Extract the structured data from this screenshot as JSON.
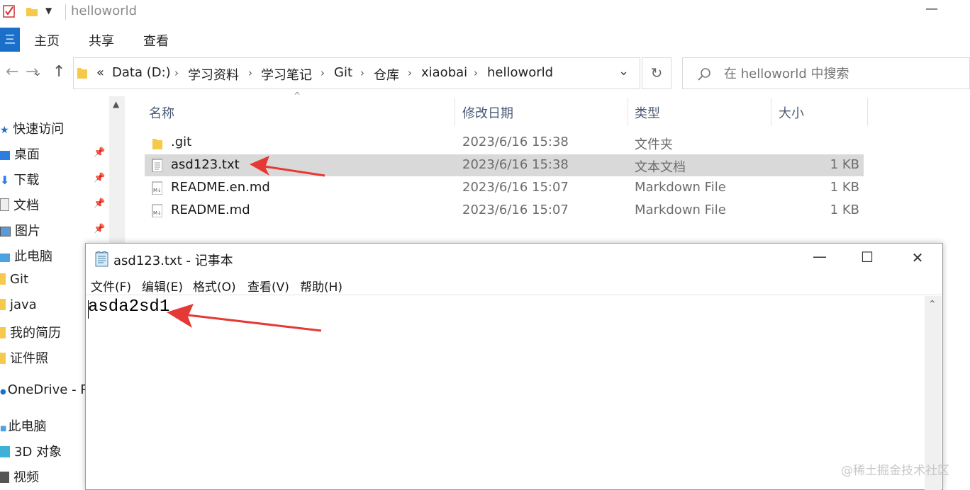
{
  "window": {
    "title": "helloworld",
    "minimize": "—"
  },
  "ribbon": {
    "file_tab": "三",
    "tabs": [
      "主页",
      "共享",
      "查看"
    ]
  },
  "address": {
    "overflow": "«",
    "crumbs": [
      "Data (D:)",
      "学习资料",
      "学习笔记",
      "Git",
      "仓库",
      "xiaobai",
      "helloworld"
    ],
    "separator": "›",
    "dropdown": "⌄",
    "refresh": "↻"
  },
  "search": {
    "placeholder": "在 helloworld 中搜索"
  },
  "nav_buttons": {
    "back": "←",
    "forward": "→",
    "recent": "⌄",
    "up": "↑"
  },
  "sidebar": {
    "items": [
      {
        "label": "快速访问",
        "pinned": false
      },
      {
        "label": "桌面",
        "pinned": true
      },
      {
        "label": "下载",
        "pinned": true
      },
      {
        "label": "文档",
        "pinned": true
      },
      {
        "label": "图片",
        "pinned": true
      },
      {
        "label": "此电脑",
        "pinned": false
      },
      {
        "label": "Git",
        "pinned": false
      },
      {
        "label": "java",
        "pinned": false
      },
      {
        "label": "我的简历",
        "pinned": false
      },
      {
        "label": "证件照",
        "pinned": false
      },
      {
        "label": "OneDrive - P",
        "pinned": false
      },
      {
        "label": "此电脑",
        "pinned": false
      },
      {
        "label": "3D 对象",
        "pinned": false
      },
      {
        "label": "视频",
        "pinned": false
      }
    ]
  },
  "file_list": {
    "columns": [
      "名称",
      "修改日期",
      "类型",
      "大小"
    ],
    "rows": [
      {
        "name": ".git",
        "date": "2023/6/16 15:38",
        "type": "文件夹",
        "size": "",
        "icon": "folder-icon",
        "selected": false
      },
      {
        "name": "asd123.txt",
        "date": "2023/6/16 15:38",
        "type": "文本文档",
        "size": "1 KB",
        "icon": "text-file-icon",
        "selected": true
      },
      {
        "name": "README.en.md",
        "date": "2023/6/16 15:07",
        "type": "Markdown File",
        "size": "1 KB",
        "icon": "markdown-file-icon",
        "selected": false
      },
      {
        "name": "README.md",
        "date": "2023/6/16 15:07",
        "type": "Markdown File",
        "size": "1 KB",
        "icon": "markdown-file-icon",
        "selected": false
      }
    ]
  },
  "notepad": {
    "title": "asd123.txt - 记事本",
    "menu": [
      "文件(F)",
      "编辑(E)",
      "格式(O)",
      "查看(V)",
      "帮助(H)"
    ],
    "content": "asda2sd1",
    "minimize": "—",
    "maximize": "☐",
    "close": "✕"
  },
  "watermark": "@稀土掘金技术社区",
  "colors": {
    "accent": "#1a6fc9",
    "selection": "#d9d9d9",
    "arrow": "#e53935",
    "folder": "#f6c94b"
  }
}
